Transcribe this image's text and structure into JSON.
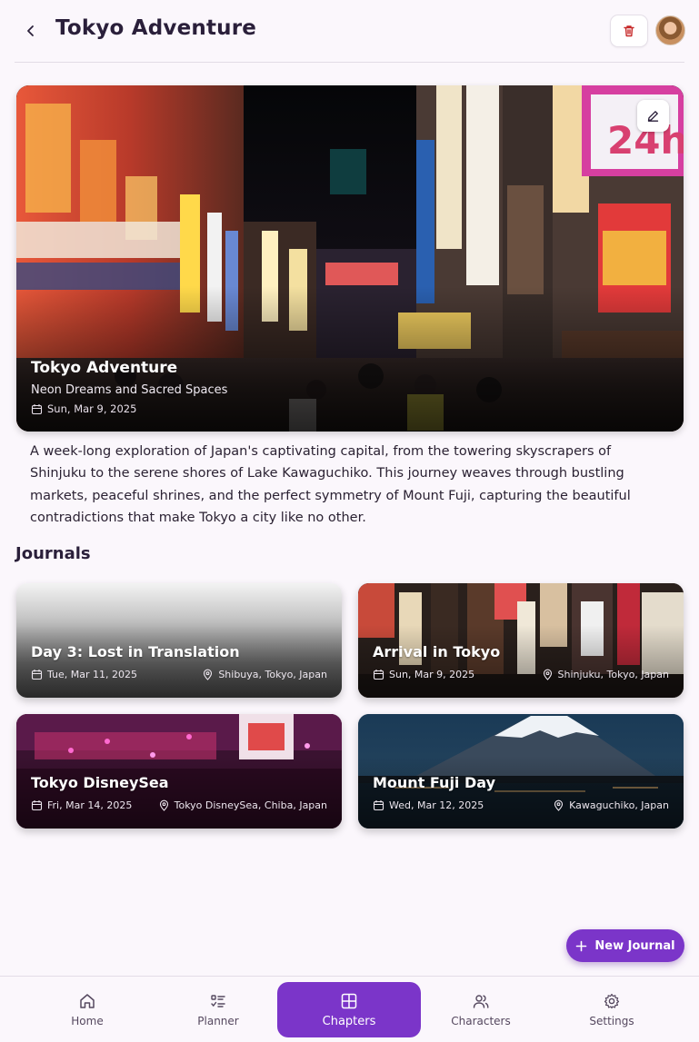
{
  "header": {
    "title": "Tokyo Adventure"
  },
  "hero": {
    "title": "Tokyo Adventure",
    "subtitle": "Neon Dreams and Sacred Spaces",
    "date": "Sun, Mar 9, 2025"
  },
  "description": "A week-long exploration of Japan's captivating capital, from the towering skyscrapers of Shinjuku to the serene shores of Lake Kawaguchiko. This journey weaves through bustling markets, peaceful shrines, and the perfect symmetry of Mount Fuji, capturing the beautiful contradictions that make Tokyo a city like no other.",
  "journals": {
    "title": "Journals",
    "items": [
      {
        "title": "Day 3: Lost in Translation",
        "date": "Tue, Mar 11, 2025",
        "location": "Shibuya, Tokyo, Japan"
      },
      {
        "title": "Arrival in Tokyo",
        "date": "Sun, Mar 9, 2025",
        "location": "Shinjuku, Tokyo, Japan"
      },
      {
        "title": "Tokyo DisneySea",
        "date": "Fri, Mar 14, 2025",
        "location": "Tokyo DisneySea, Chiba, Japan"
      },
      {
        "title": "Mount Fuji Day",
        "date": "Wed, Mar 12, 2025",
        "location": "Kawaguchiko, Japan"
      }
    ]
  },
  "fab": {
    "label": "New Journal"
  },
  "nav": {
    "items": [
      {
        "label": "Home",
        "icon": "home-icon"
      },
      {
        "label": "Planner",
        "icon": "checklist-icon"
      },
      {
        "label": "Chapters",
        "icon": "grid-icon",
        "active": true
      },
      {
        "label": "Characters",
        "icon": "users-icon"
      },
      {
        "label": "Settings",
        "icon": "gear-icon"
      }
    ]
  },
  "colors": {
    "accent": "#7b35c9",
    "background": "#fbf7fc",
    "delete": "#c62828"
  },
  "hero_sign_text": [
    "24h"
  ]
}
